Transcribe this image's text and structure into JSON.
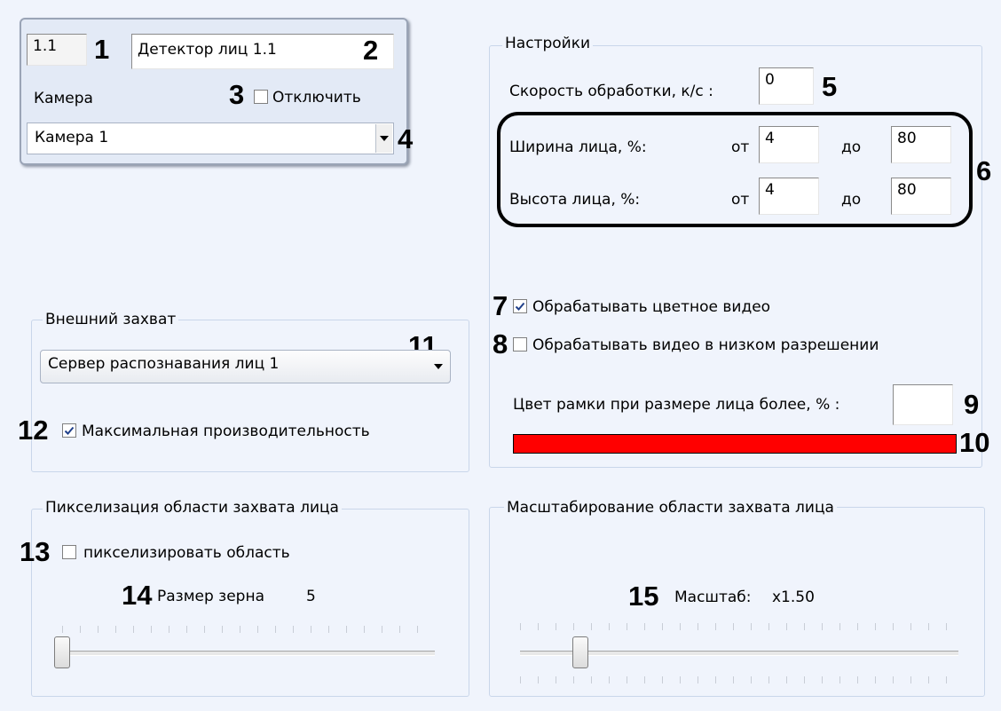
{
  "detector": {
    "id": "1.1",
    "name": "Детектор лиц 1.1",
    "camera_label": "Камера",
    "disable_label": "Отключить",
    "disable_checked": false,
    "camera_value": "Камера 1"
  },
  "settings": {
    "title": "Настройки",
    "speed_label": "Скорость обработки, к/с :",
    "speed_value": "0",
    "face_width_label": "Ширина лица, %:",
    "face_height_label": "Высота лица, %:",
    "from_label": "от",
    "to_label": "до",
    "width_from": "4",
    "width_to": "80",
    "height_from": "4",
    "height_to": "80",
    "color_video_label": "Обрабатывать цветное видео",
    "color_video_checked": true,
    "low_res_label": "Обрабатывать видео в низком разрешении",
    "low_res_checked": false,
    "frame_color_label": "Цвет рамки при размере лица более, % :",
    "frame_color_value": "",
    "frame_color": "#ff0000"
  },
  "external_capture": {
    "title": "Внешний захват",
    "server_value": "Сервер распознавания лиц 1",
    "max_performance_label": "Максимальная производительность",
    "max_performance_checked": true
  },
  "pixelization": {
    "title": "Пикселизация области захвата лица",
    "pixelize_label": "пикселизировать область",
    "pixelize_checked": false,
    "grain_label": "Размер зерна",
    "grain_value": "5",
    "slider_value": 5
  },
  "scaling": {
    "title": "Масштабирование области захвата лица",
    "scale_label": "Масштаб:",
    "scale_value": "x1.50",
    "slider_value": 1.5
  },
  "markers": [
    "1",
    "2",
    "3",
    "4",
    "5",
    "6",
    "7",
    "8",
    "9",
    "10",
    "11",
    "12",
    "13",
    "14",
    "15"
  ]
}
